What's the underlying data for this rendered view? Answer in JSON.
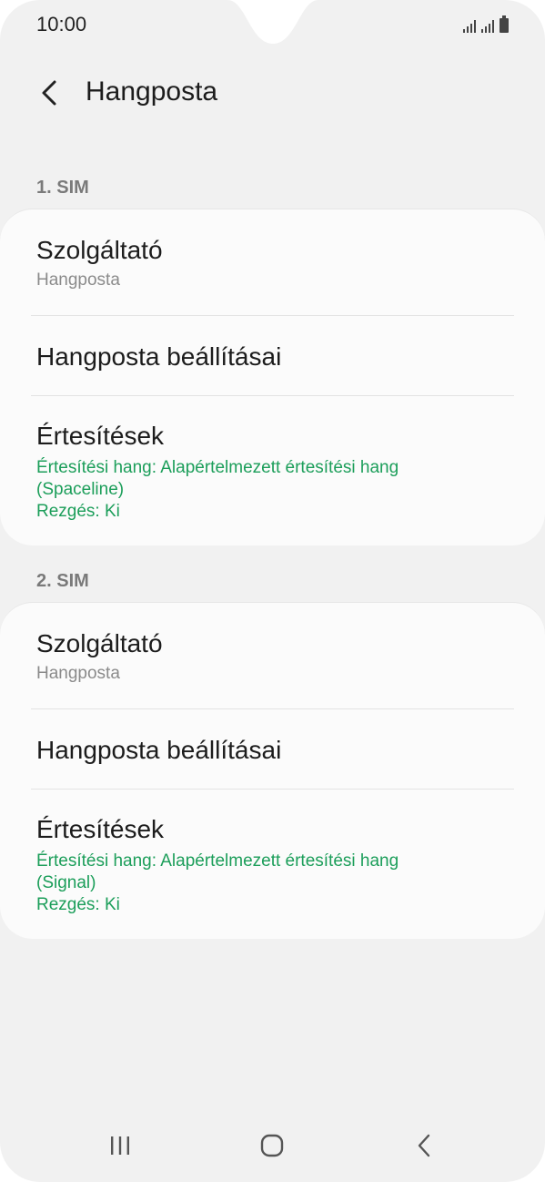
{
  "status_bar": {
    "time": "10:00"
  },
  "header": {
    "title": "Hangposta"
  },
  "sim1": {
    "label": "1. SIM",
    "provider": {
      "title": "Szolgáltató",
      "subtitle": "Hangposta"
    },
    "voicemail_settings": {
      "title": "Hangposta beállításai"
    },
    "notifications": {
      "title": "Értesítések",
      "sound_line1": "Értesítési hang: Alapértelmezett értesítési hang",
      "sound_line2": "(Spaceline)",
      "vibration": "Rezgés: Ki"
    }
  },
  "sim2": {
    "label": "2. SIM",
    "provider": {
      "title": "Szolgáltató",
      "subtitle": "Hangposta"
    },
    "voicemail_settings": {
      "title": "Hangposta beállításai"
    },
    "notifications": {
      "title": "Értesítések",
      "sound_line1": "Értesítési hang: Alapértelmezett értesítési hang",
      "sound_line2": "(Signal)",
      "vibration": "Rezgés: Ki"
    }
  },
  "colors": {
    "accent_green": "#1c9e5a",
    "background": "#f1f1f1",
    "card": "#fbfbfb"
  },
  "icons": {
    "back": "chevron-left-icon",
    "recents": "recents-icon",
    "home": "home-icon",
    "nav_back": "nav-back-icon",
    "signal": "signal-icon",
    "battery": "battery-icon"
  }
}
